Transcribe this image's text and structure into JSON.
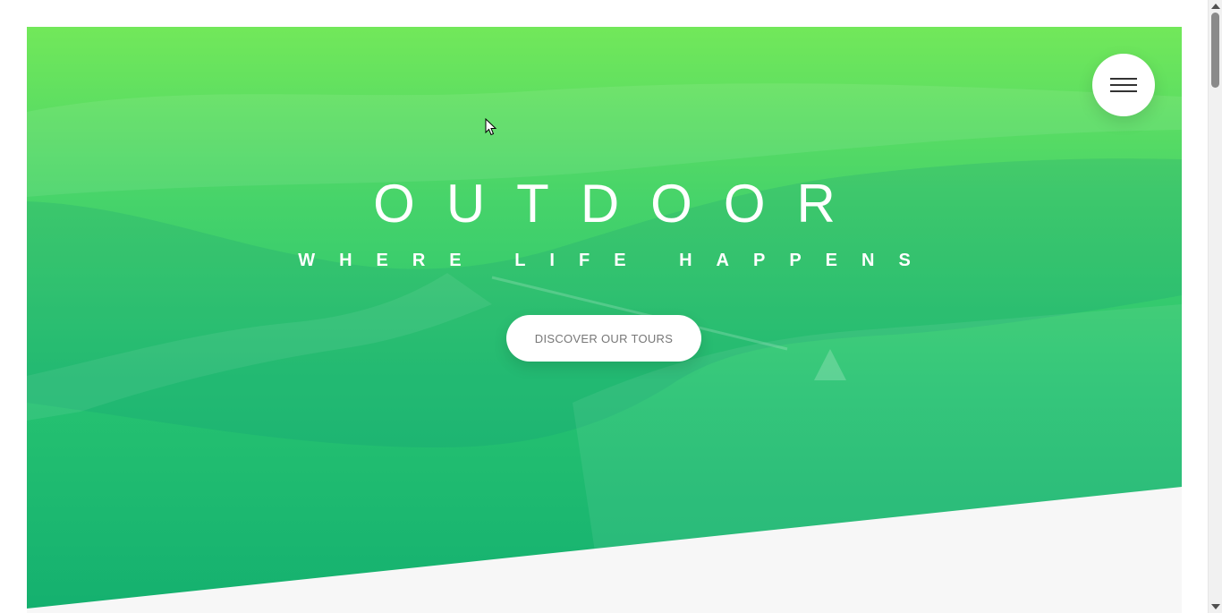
{
  "hero": {
    "title": "OUTDOOR",
    "subtitle": "WHERE LIFE HAPPENS",
    "cta_label": "DISCOVER OUR TOURS",
    "gradient_top": "#72e85a",
    "gradient_bottom": "#14b06f"
  },
  "navigation": {
    "menu_icon": "hamburger-menu-icon"
  },
  "colors": {
    "page_background": "#ffffff",
    "section_background": "#f7f7f7",
    "cta_text": "#777777",
    "hero_text": "#ffffff"
  }
}
